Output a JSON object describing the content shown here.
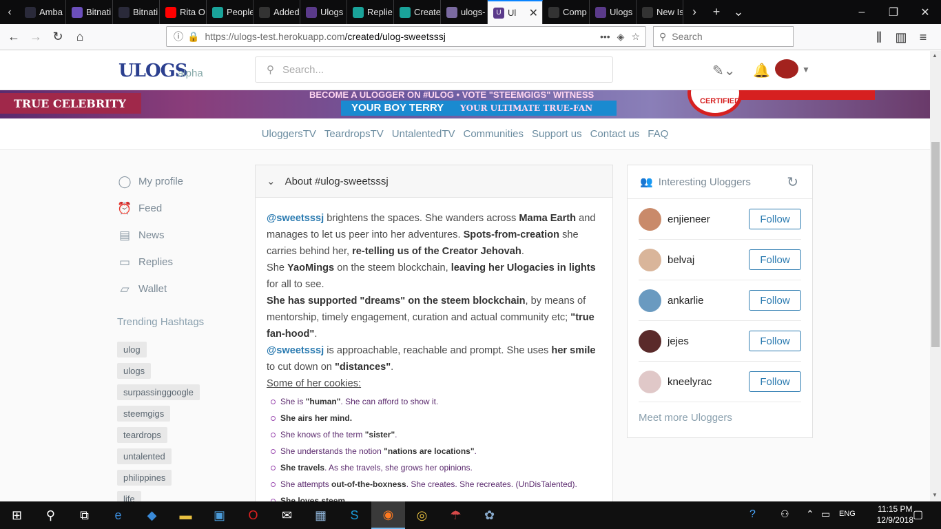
{
  "browser": {
    "tabs": [
      {
        "label": "Amba",
        "fav_color": "#2a2a3a"
      },
      {
        "label": "Bitnati",
        "fav_color": "#6b4fbb"
      },
      {
        "label": "Bitnati",
        "fav_color": "#2a2a3a"
      },
      {
        "label": "Rita O",
        "fav_color": "#ff0000"
      },
      {
        "label": "People",
        "fav_color": "#1aa39a"
      },
      {
        "label": "Added",
        "fav_color": "#333333"
      },
      {
        "label": "Ulogs",
        "fav_color": "#5a3a8a"
      },
      {
        "label": "Replie",
        "fav_color": "#1aa39a"
      },
      {
        "label": "Create",
        "fav_color": "#1aa39a"
      },
      {
        "label": "ulogs-",
        "fav_color": "#7a6aa0"
      }
    ],
    "active_tab": {
      "label": "Ul",
      "fav_color": "#5a3a8a"
    },
    "tabs_after": [
      {
        "label": "Comp",
        "fav_color": "#333333"
      },
      {
        "label": "Ulogs",
        "fav_color": "#5a3a8a"
      },
      {
        "label": "New Is",
        "fav_color": "#333333"
      }
    ],
    "url_domain": "https://ulogs-test.herokuapp.com",
    "url_path": "/created/ulog-sweetsssj",
    "search_placeholder": "Search"
  },
  "site": {
    "logo": "ULOGS",
    "alpha": "alpha",
    "search_placeholder": "Search...",
    "banner": {
      "left": "TRUE CELEBRITY",
      "line1": "BECOME A ULOGGER ON #ULOG • VOTE \"STEEMGIGS\" WITNESS",
      "line2a": "YOUR BOY TERRY",
      "line2b": "YOUR ULTIMATE TRUE-FAN",
      "badge": "CERTIFIED"
    },
    "subnav": [
      "UloggersTV",
      "TeardropsTV",
      "UntalentedTV",
      "Communities",
      "Support us",
      "Contact us",
      "FAQ"
    ]
  },
  "leftnav": {
    "items": [
      {
        "label": "My profile",
        "icon": "user-icon"
      },
      {
        "label": "Feed",
        "icon": "clock-icon"
      },
      {
        "label": "News",
        "icon": "news-icon"
      },
      {
        "label": "Replies",
        "icon": "replies-icon"
      },
      {
        "label": "Wallet",
        "icon": "wallet-icon"
      }
    ],
    "trending_title": "Trending Hashtags",
    "tags": [
      "ulog",
      "ulogs",
      "surpassinggoogle",
      "steemgigs",
      "teardrops",
      "untalented",
      "philippines",
      "life"
    ]
  },
  "about": {
    "title": "About #ulog-sweetsssj",
    "p1": {
      "mention": "@sweetsssj",
      "t1": " brightens the spaces. She wanders across ",
      "b1": "Mama Earth",
      "t2": " and manages to let us peer into her adventures. ",
      "b2": "Spots-from-creation",
      "t3": " she carries behind her, ",
      "b3": "re-telling us of the Creator Jehovah",
      "t4": "."
    },
    "p2": {
      "t1": "She ",
      "b1": "YaoMings",
      "t2": " on the steem blockchain, ",
      "b2": "leaving her Ulogacies in lights",
      "t3": " for all to see."
    },
    "p3": {
      "b1": "She has supported \"dreams\" on the steem blockchain",
      "t1": ", by means of mentorship, timely engagement, curation and actual community etc; ",
      "b2": "\"true fan-hood\"",
      "t2": "."
    },
    "p4": {
      "mention": "@sweetsssj",
      "t1": " is approachable, reachable and prompt. She uses ",
      "b1": "her smile",
      "t2": " to cut down on ",
      "b2": "\"distances\"",
      "t3": "."
    },
    "cookies_title": "Some of her cookies:",
    "cookies": [
      {
        "t1": "She is ",
        "b1": "\"human\"",
        "t2": ". She can afford to show it."
      },
      {
        "t1": "",
        "b1": "She airs her mind.",
        "t2": ""
      },
      {
        "t1": "She knows of the term ",
        "b1": "\"sister\"",
        "t2": "."
      },
      {
        "t1": "She understands the notion ",
        "b1": "\"nations are locations\"",
        "t2": "."
      },
      {
        "t1": "",
        "b1": "She travels",
        "t2": ". As she travels, she grows her opinions."
      },
      {
        "t1": "She attempts ",
        "b1": "out-of-the-boxness",
        "t2": ". She creates. She recreates. (UnDisTalented)."
      },
      {
        "t1": "",
        "b1": "She loves steem.",
        "t2": ""
      }
    ]
  },
  "interesting": {
    "title": "Interesting Uloggers",
    "users": [
      {
        "name": "enjieneer",
        "follow": "Follow",
        "av": "#c98a6a"
      },
      {
        "name": "belvaj",
        "follow": "Follow",
        "av": "#d9b59a"
      },
      {
        "name": "ankarlie",
        "follow": "Follow",
        "av": "#6a9ac0"
      },
      {
        "name": "jejes",
        "follow": "Follow",
        "av": "#5a2a2a"
      },
      {
        "name": "kneelyrac",
        "follow": "Follow",
        "av": "#e0c8c8"
      }
    ],
    "meet_more": "Meet more Uloggers"
  },
  "taskbar": {
    "time": "11:15 PM",
    "date": "12/9/2018",
    "lang": "ENG"
  }
}
